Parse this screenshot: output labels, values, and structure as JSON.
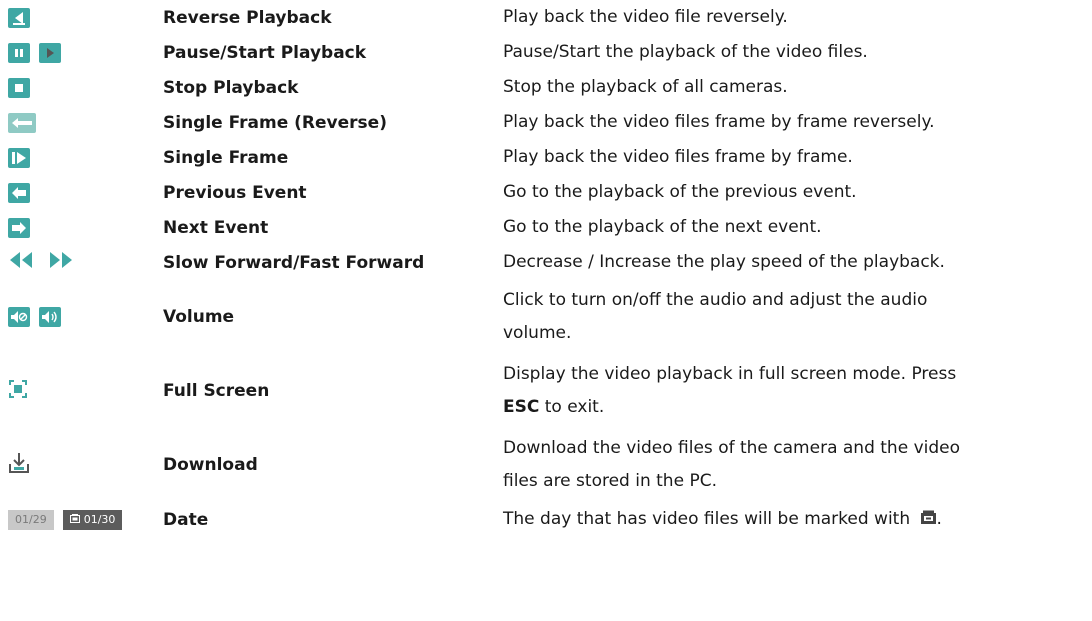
{
  "rows": [
    {
      "icons": [
        "reverse-playback-icon"
      ],
      "name": "Reverse Playback",
      "desc": "Play back the video file reversely."
    },
    {
      "icons": [
        "pause-icon",
        "play-icon"
      ],
      "name": "Pause/Start Playback",
      "desc": "Pause/Start the playback of the video files."
    },
    {
      "icons": [
        "stop-icon"
      ],
      "name": "Stop Playback",
      "desc": "Stop the playback of all cameras."
    },
    {
      "icons": [
        "single-frame-reverse-icon"
      ],
      "name": "Single Frame (Reverse)",
      "desc": "Play back the video files frame by frame reversely."
    },
    {
      "icons": [
        "single-frame-icon"
      ],
      "name": "Single Frame",
      "desc": "Play back the video files frame by frame."
    },
    {
      "icons": [
        "previous-event-icon"
      ],
      "name": "Previous Event",
      "desc": "Go to the playback of the previous event."
    },
    {
      "icons": [
        "next-event-icon"
      ],
      "name": "Next Event",
      "desc": "Go to the playback of the next event."
    },
    {
      "icons": [
        "slow-forward-icon",
        "fast-forward-icon"
      ],
      "name": "Slow Forward/Fast Forward",
      "desc": "Decrease / Increase the play speed of the playback."
    },
    {
      "icons": [
        "volume-off-icon",
        "volume-on-icon"
      ],
      "name": "Volume",
      "desc_l1": "Click to turn on/off the audio and adjust the audio",
      "desc_l2": "volume."
    },
    {
      "icons": [
        "full-screen-icon"
      ],
      "name": "Full Screen",
      "desc_l1": "Display the video playback in full screen mode. Press",
      "desc_bold": "ESC",
      "desc_tail": " to exit."
    },
    {
      "icons": [
        "download-icon"
      ],
      "name": "Download",
      "desc_l1": "Download the video files of the camera and the video",
      "desc_l2": "files are stored in the PC."
    },
    {
      "icons": [
        "date-plain",
        "date-marked"
      ],
      "name": "Date",
      "dates": [
        "01/29",
        "01/30"
      ],
      "desc": "The day that has video files will be marked with",
      "desc_end": "."
    }
  ],
  "colors": {
    "icon_teal": "#3fa7a4",
    "icon_teal_light": "#8fcac4"
  }
}
